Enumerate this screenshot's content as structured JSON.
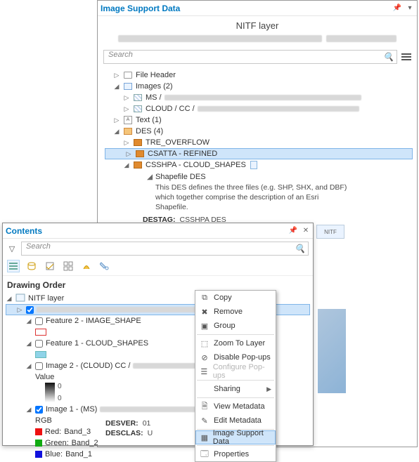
{
  "isd": {
    "title": "Image Support Data",
    "subtitle": "NITF layer",
    "search_placeholder": "Search",
    "tree": {
      "file_header": "File Header",
      "images": "Images (2)",
      "ms_prefix": "MS /",
      "cloud_prefix": "CLOUD / CC /",
      "text": "Text (1)",
      "des": "DES (4)",
      "tre": "TRE_OVERFLOW",
      "csatta": "CSATTA - REFINED",
      "csshpa": "CSSHPA - CLOUD_SHAPES",
      "shapefile_title": "Shapefile DES",
      "shapefile_desc": "This DES defines the three files (e.g. SHP, SHX, and DBF) which together comprise the description of an Esri Shapefile.",
      "destag_k": "DESTAG:",
      "destag_v": "CSSHPA DES",
      "desver_k": "DESVER:",
      "desver_v": "01"
    }
  },
  "contents": {
    "title": "Contents",
    "search_placeholder": "Search",
    "heading": "Drawing Order",
    "root": "NITF layer",
    "feature2": "Feature 2 - IMAGE_SHAPE",
    "feature1": "Feature 1 - CLOUD_SHAPES",
    "image2": "Image 2 - (CLOUD) CC /",
    "value_label": "Value",
    "value_top": "0",
    "value_bot": "0",
    "image1": "Image 1 - (MS)",
    "rgb": "RGB",
    "red": "Red:",
    "red_v": "Band_3",
    "green": "Green:",
    "green_v": "Band_2",
    "blue": "Blue:",
    "blue_v": "Band_1"
  },
  "ctx": {
    "copy": "Copy",
    "remove": "Remove",
    "group": "Group",
    "zoom": "Zoom To Layer",
    "disable_popups": "Disable Pop-ups",
    "configure_popups": "Configure Pop-ups",
    "sharing": "Sharing",
    "view_meta": "View Metadata",
    "edit_meta": "Edit Metadata",
    "isd": "Image Support Data",
    "props": "Properties"
  },
  "bottom": {
    "desver_k": "DESVER:",
    "desver_v": "01",
    "desclas_k": "DESCLAS:",
    "desclas_v": "U"
  },
  "dock_tab": "NITF"
}
